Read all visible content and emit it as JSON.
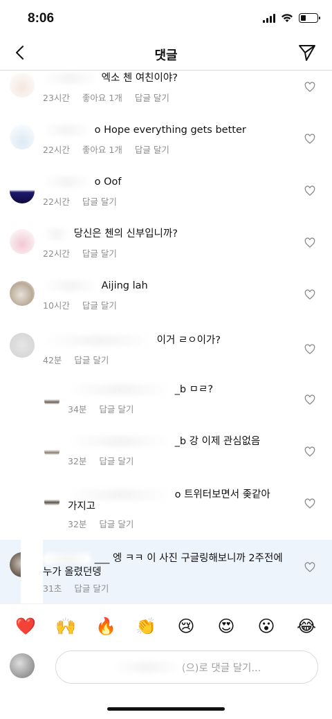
{
  "status": {
    "time": "8:06"
  },
  "nav": {
    "title": "댓글"
  },
  "comments": [
    {
      "text": "엑소 첸 여친이야?",
      "time": "23시간",
      "likes": "좋아요 1개",
      "reply": "답글 달기"
    },
    {
      "text": "o Hope everything gets better",
      "time": "22시간",
      "likes": "좋아요 1개",
      "reply": "답글 달기"
    },
    {
      "text": "o Oof",
      "time": "22시간",
      "reply": "답글 달기"
    },
    {
      "text": "당신은 첸의 신부입니까?",
      "time": "22시간",
      "reply": "답글 달기"
    },
    {
      "text": "Aijing lah",
      "time": "10시간",
      "reply": "답글 달기"
    },
    {
      "text": "이거 ㄹㅇ이가?",
      "time": "42분",
      "reply": "답글 달기"
    },
    {
      "text": "_b ㅁㄹ?",
      "time": "34분",
      "reply": "답글 달기"
    },
    {
      "text": "_b 강 이제 관심없음",
      "time": "32분",
      "reply": "답글 달기"
    },
    {
      "text": "o 트위터보면서 좆같아",
      "text2": "가지고",
      "time": "32분",
      "reply": "답글 달기"
    },
    {
      "text": "___ 엥 ㅋㅋ 이 사진 구글링해보니까 2주전에",
      "text2": "누가 올렸던뎅",
      "time": "31초",
      "reply": "답글 달기"
    }
  ],
  "emojis": [
    "❤️",
    "🙌",
    "🔥",
    "👏",
    "😢",
    "😍",
    "😮",
    "😂"
  ],
  "input": {
    "placeholder": "(으)로 댓글 달기..."
  },
  "icons": {
    "back": "chevron-left-icon",
    "send": "paper-plane-icon",
    "heart": "heart-outline-icon"
  }
}
